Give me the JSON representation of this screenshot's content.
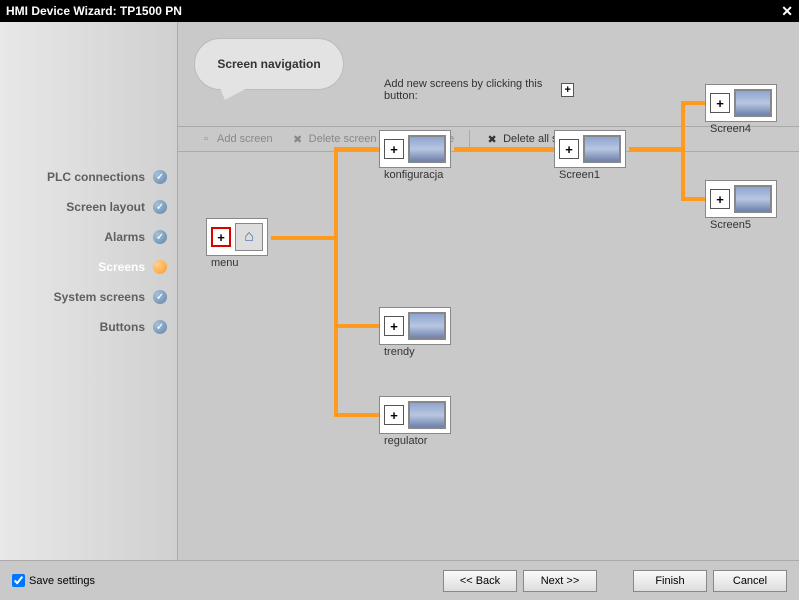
{
  "window": {
    "title": "HMI Device Wizard: TP1500 PN"
  },
  "sidebar": {
    "items": [
      {
        "label": "PLC connections",
        "state": "done"
      },
      {
        "label": "Screen layout",
        "state": "done"
      },
      {
        "label": "Alarms",
        "state": "done"
      },
      {
        "label": "Screens",
        "state": "active"
      },
      {
        "label": "System screens",
        "state": "done"
      },
      {
        "label": "Buttons",
        "state": "done"
      }
    ]
  },
  "bubble": {
    "title": "Screen navigation",
    "hint": "Add new screens by clicking this button:"
  },
  "toolbar": {
    "add": "Add screen",
    "delete": "Delete screen",
    "rename": "Rename",
    "deleteAll": "Delete all screens"
  },
  "nodes": {
    "menu": {
      "label": "menu"
    },
    "konfiguracja": {
      "label": "konfiguracja"
    },
    "trendy": {
      "label": "trendy"
    },
    "regulator": {
      "label": "regulator"
    },
    "screen1": {
      "label": "Screen1"
    },
    "screen4": {
      "label": "Screen4"
    },
    "screen5": {
      "label": "Screen5"
    }
  },
  "footer": {
    "save": "Save settings",
    "back": "<< Back",
    "next": "Next >>",
    "finish": "Finish",
    "cancel": "Cancel"
  }
}
